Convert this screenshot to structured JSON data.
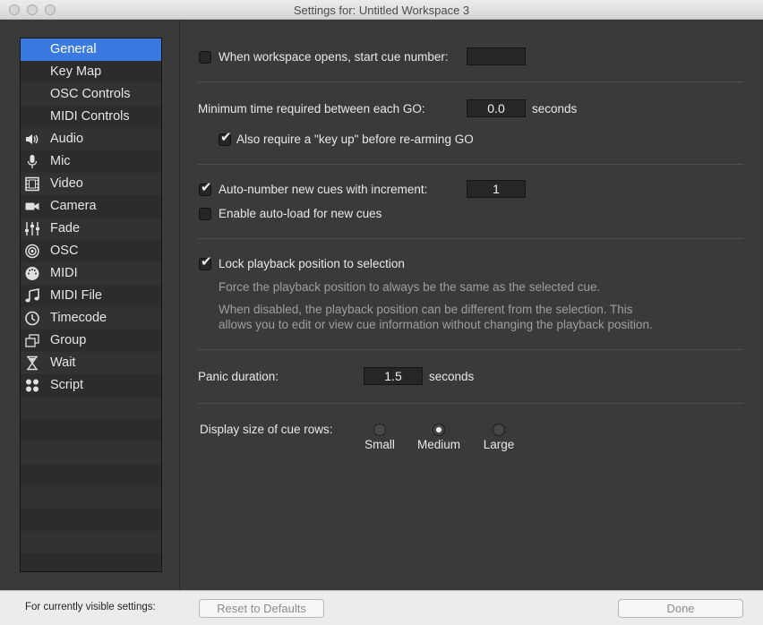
{
  "window": {
    "title": "Settings for: Untitled Workspace 3"
  },
  "sidebar": {
    "items": [
      {
        "label": "General",
        "icon": "none",
        "selected": true
      },
      {
        "label": "Key Map",
        "icon": "none"
      },
      {
        "label": "OSC Controls",
        "icon": "none"
      },
      {
        "label": "MIDI Controls",
        "icon": "none"
      },
      {
        "label": "Audio",
        "icon": "speaker-icon"
      },
      {
        "label": "Mic",
        "icon": "microphone-icon"
      },
      {
        "label": "Video",
        "icon": "film-icon"
      },
      {
        "label": "Camera",
        "icon": "camera-icon"
      },
      {
        "label": "Fade",
        "icon": "sliders-icon"
      },
      {
        "label": "OSC",
        "icon": "osc-target-icon"
      },
      {
        "label": "MIDI",
        "icon": "midi-connector-icon"
      },
      {
        "label": "MIDI File",
        "icon": "music-note-icon"
      },
      {
        "label": "Timecode",
        "icon": "clock-icon"
      },
      {
        "label": "Group",
        "icon": "group-icon"
      },
      {
        "label": "Wait",
        "icon": "hourglass-icon"
      },
      {
        "label": "Script",
        "icon": "script-dots-icon"
      }
    ]
  },
  "general": {
    "start_cue": {
      "label": "When workspace opens, start cue number:",
      "value": "",
      "checked": false
    },
    "min_go": {
      "label": "Minimum time required between each GO:",
      "value": "0.0",
      "unit": "seconds"
    },
    "key_up": {
      "label": "Also require a \"key up\" before re-arming GO",
      "checked": true
    },
    "auto_number": {
      "label": "Auto-number new cues with increment:",
      "value": "1",
      "checked": true
    },
    "auto_load": {
      "label": "Enable auto-load for new cues",
      "checked": false
    },
    "lock_playback": {
      "label": "Lock playback position to selection",
      "checked": true,
      "desc1": "Force the playback position to always be the same as the selected cue.",
      "desc2_line1": "When disabled, the playback position can be different from the selection. This",
      "desc2_line2": "allows you to edit or view cue information without changing the playback position."
    },
    "panic": {
      "label": "Panic duration:",
      "value": "1.5",
      "unit": "seconds"
    },
    "cue_rows": {
      "label": "Display size of cue rows:",
      "options": [
        "Small",
        "Medium",
        "Large"
      ],
      "selected": "Medium"
    }
  },
  "footer": {
    "label": "For currently visible settings:",
    "reset_label": "Reset to Defaults",
    "done_label": "Done"
  }
}
